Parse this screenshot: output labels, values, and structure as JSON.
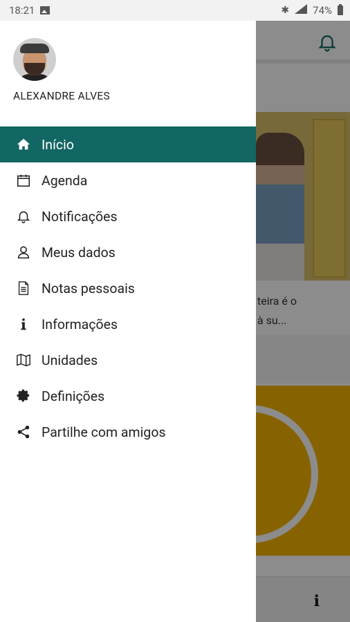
{
  "status_bar": {
    "time": "18:21",
    "battery": "74%"
  },
  "drawer": {
    "user_name": "ALEXANDRE ALVES",
    "menu": [
      {
        "label": "Início",
        "icon": "home-icon",
        "active": true
      },
      {
        "label": "Agenda",
        "icon": "calendar-icon"
      },
      {
        "label": "Notificações",
        "icon": "bell-icon"
      },
      {
        "label": "Meus dados",
        "icon": "user-icon"
      },
      {
        "label": "Notas pessoais",
        "icon": "document-icon"
      },
      {
        "label": "Informações",
        "icon": "info-icon"
      },
      {
        "label": "Unidades",
        "icon": "map-icon"
      },
      {
        "label": "Definições",
        "icon": "gear-icon"
      },
      {
        "label": "Partilhe com amigos",
        "icon": "share-icon"
      }
    ],
    "active_color": "#126663"
  },
  "background": {
    "snippet_line1": "teira é o",
    "snippet_line2": "à su..."
  }
}
